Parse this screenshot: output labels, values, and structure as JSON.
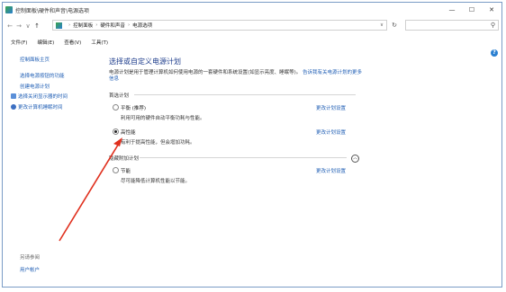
{
  "window": {
    "title": "控制面板\\硬件和声音\\电源选项",
    "minimize": "—",
    "maximize": "☐",
    "close": "✕"
  },
  "address": {
    "back": "←",
    "forward": "→",
    "history": "∨",
    "up": "↑",
    "crumbs": [
      "控制面板",
      "硬件和声音",
      "电源选项"
    ],
    "separator": "›",
    "dropdown": "∨",
    "refresh": "↻",
    "search_icon": "⚲"
  },
  "menu": [
    "文件(F)",
    "编辑(E)",
    "查看(V)",
    "工具(T)"
  ],
  "help_icon": "?",
  "sidebar": {
    "items": [
      {
        "label": "控制面板主页"
      },
      {
        "label": "选择电源按钮的功能"
      },
      {
        "label": "创建电源计划"
      },
      {
        "label": "选择关闭显示器的时间"
      },
      {
        "label": "更改计算机睡眠时间"
      }
    ],
    "see_also": "另请参阅",
    "user_accounts": "用户帐户"
  },
  "main": {
    "heading": "选择或自定义电源计划",
    "description": "电源计划是用于管理计算机如何使用电源的一套硬件和系统设置(如显示亮度、睡眠等)。",
    "description_link": "告诉我有关电源计划的更多信息",
    "preferred_group": "首选计划",
    "hidden_group": "隐藏附加计划",
    "plans": [
      {
        "name": "平衡 (推荐)",
        "desc": "利用可用的硬件自动平衡功耗与性能。",
        "selected": false,
        "change": "更改计划设置"
      },
      {
        "name": "高性能",
        "desc": "有利于提高性能，但会增加功耗。",
        "selected": true,
        "change": "更改计划设置"
      },
      {
        "name": "节能",
        "desc": "尽可能降低计算机性能以节能。",
        "selected": false,
        "change": "更改计划设置"
      }
    ],
    "collapse_icon": "︿"
  },
  "colors": {
    "link": "#1e5db4",
    "heading": "#1e3d8c",
    "annotation_arrow": "#e0301e"
  }
}
